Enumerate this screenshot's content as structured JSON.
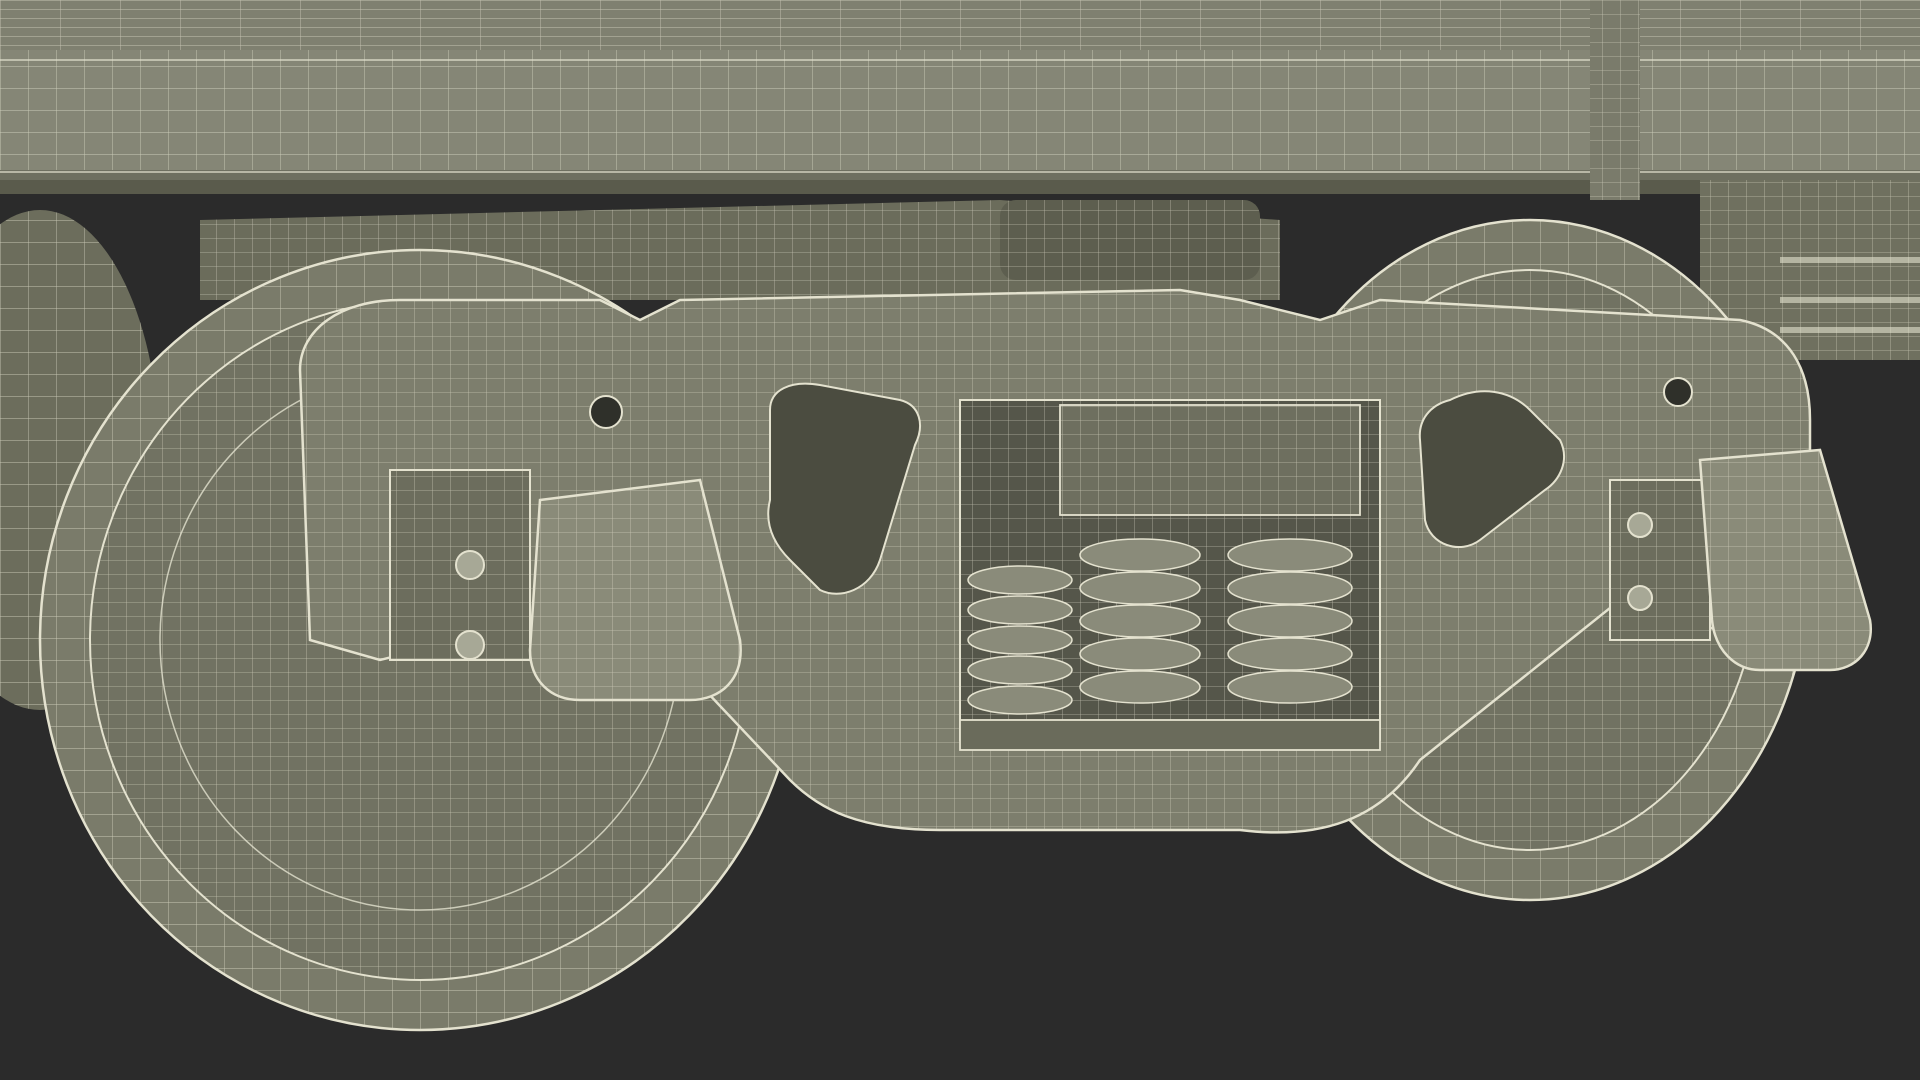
{
  "scene": {
    "subject": "rail-bogie-wireframe",
    "colors": {
      "background": "#2b2b2b",
      "surface": "#7d7e6e",
      "surface_dark": "#5f604f",
      "surface_darker": "#4a4b3e",
      "surface_light": "#8c8d7c",
      "wire": "#e4e2cf",
      "wire_faint": "#c9c8b4",
      "shadow": "#3a3b32"
    }
  }
}
